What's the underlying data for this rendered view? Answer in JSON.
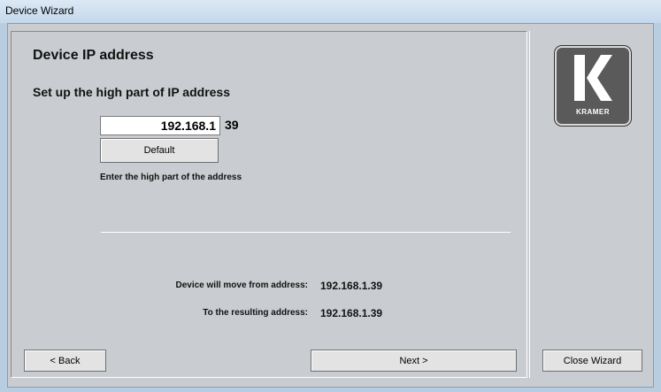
{
  "window": {
    "title": "Device Wizard"
  },
  "main": {
    "heading": "Device IP address",
    "subheading": "Set up the high part of IP address",
    "ip_input_value": "192.168.1",
    "ip_suffix": "39",
    "default_label": "Default",
    "hint": "Enter the high part of the address",
    "from_label": "Device will move from address:",
    "from_value": "192.168.1.39",
    "to_label": "To the resulting address:",
    "to_value": "192.168.1.39"
  },
  "buttons": {
    "back": "< Back",
    "next": "Next >",
    "close": "Close Wizard"
  },
  "logo": {
    "text": "KRAMER",
    "icon": "kramer-logo"
  }
}
